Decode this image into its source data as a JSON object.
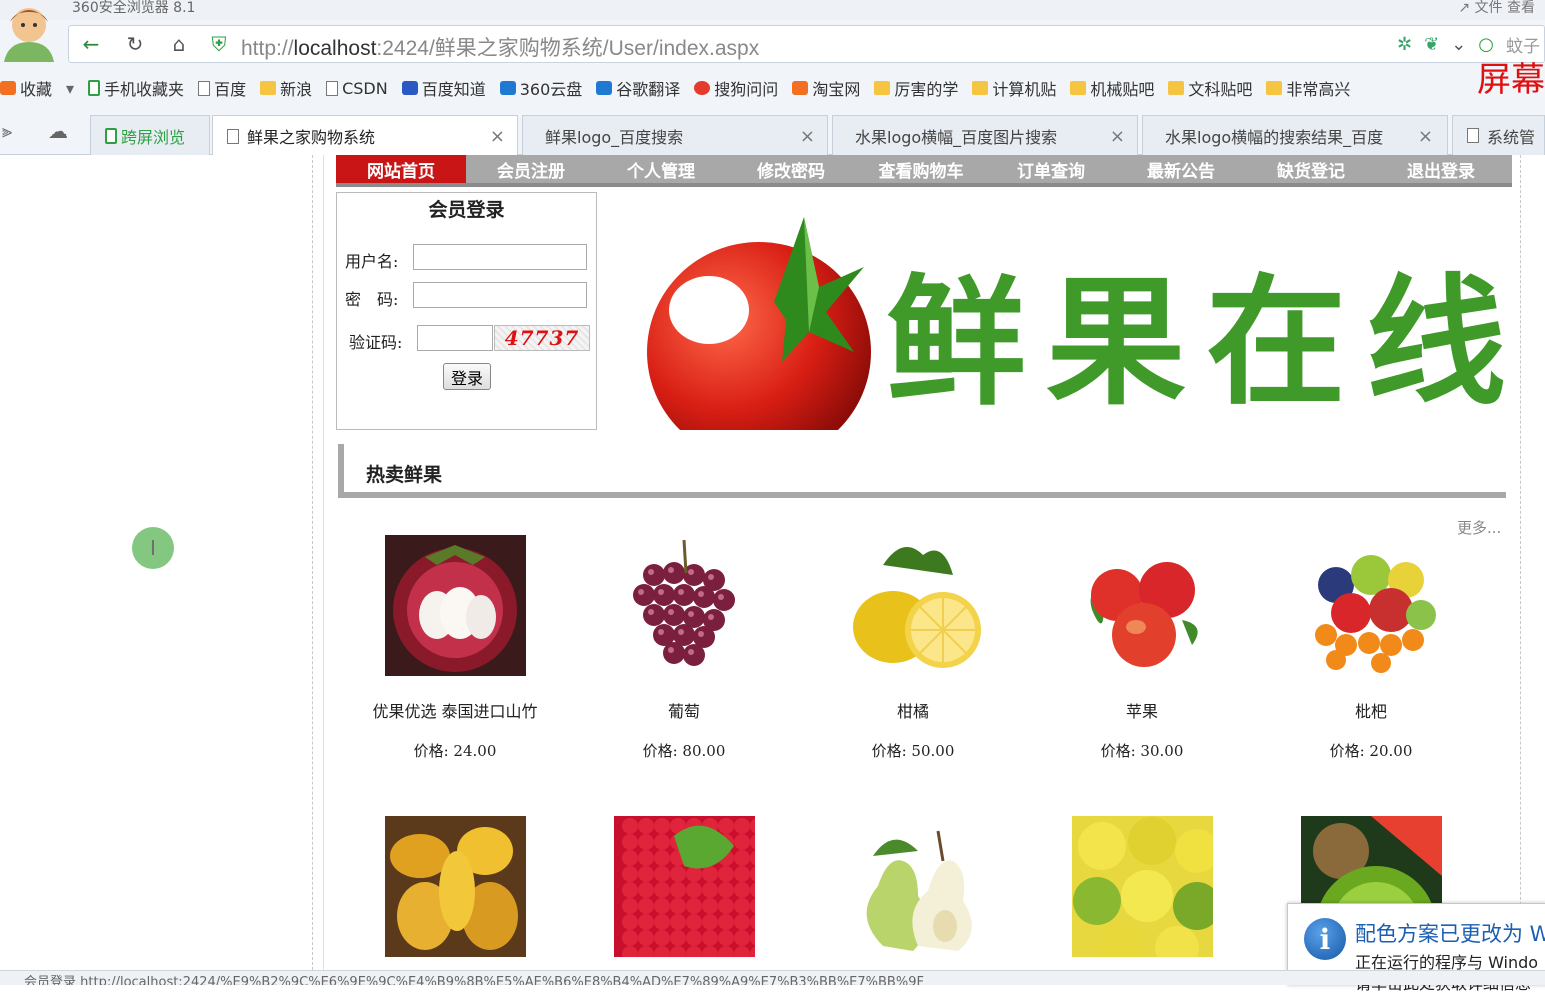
{
  "window": {
    "title": "360安全浏览器 8.1",
    "top_right": "↗ 文件    查看"
  },
  "address_bar": {
    "url_prefix": "http://",
    "url_host": "localhost",
    "url_rest": ":2424/鲜果之家购物系统/User/index.aspx",
    "search_hint": "蚊子"
  },
  "bookmarks": [
    {
      "label": "收藏",
      "icon": "star-icon"
    },
    {
      "label": "手机收藏夹",
      "icon": "phone-icon"
    },
    {
      "label": "百度",
      "icon": "page-icon"
    },
    {
      "label": "新浪",
      "icon": "folder-icon"
    },
    {
      "label": "CSDN",
      "icon": "page-icon"
    },
    {
      "label": "百度知道",
      "icon": "baidu-paw-icon"
    },
    {
      "label": "360云盘",
      "icon": "cloud-icon"
    },
    {
      "label": "谷歌翻译",
      "icon": "translate-icon"
    },
    {
      "label": "搜狗问问",
      "icon": "sogou-icon"
    },
    {
      "label": "淘宝网",
      "icon": "taobao-icon"
    },
    {
      "label": "厉害的学",
      "icon": "folder-icon"
    },
    {
      "label": "计算机贴",
      "icon": "folder-icon"
    },
    {
      "label": "机械贴吧",
      "icon": "folder-icon"
    },
    {
      "label": "文科贴吧",
      "icon": "folder-icon"
    },
    {
      "label": "非常高兴",
      "icon": "folder-icon"
    }
  ],
  "screen_label": "屏幕",
  "tabs": [
    {
      "label": "跨屏浏览"
    },
    {
      "label": "鲜果之家购物系统"
    },
    {
      "label": "鲜果logo_百度搜索"
    },
    {
      "label": "水果logo横幅_百度图片搜索"
    },
    {
      "label": "水果logo横幅的搜索结果_百度"
    },
    {
      "label": "系统管"
    }
  ],
  "site": {
    "menu": [
      "网站首页",
      "会员注册",
      "个人管理",
      "修改密码",
      "查看购物车",
      "订单查询",
      "最新公告",
      "缺货登记",
      "退出登录"
    ],
    "login": {
      "title": "会员登录",
      "username_label": "用户名:",
      "password_label": "密　码:",
      "captcha_label": "验证码:",
      "captcha_value": "47737",
      "button": "登录"
    },
    "banner_text": "鲜果在线",
    "section_title": "热卖鲜果",
    "more_link": "更多...",
    "products": [
      {
        "name": "优果优选 泰国进口山竹",
        "price": "价格: 24.00",
        "fruit": "mangosteen"
      },
      {
        "name": "葡萄",
        "price": "价格: 80.00",
        "fruit": "grape"
      },
      {
        "name": "柑橘",
        "price": "价格: 50.00",
        "fruit": "lemon"
      },
      {
        "name": "苹果",
        "price": "价格: 30.00",
        "fruit": "apple"
      },
      {
        "name": "枇杷",
        "price": "价格: 20.00",
        "fruit": "mixed-fruit"
      },
      {
        "name": "",
        "price": "",
        "fruit": "mango"
      },
      {
        "name": "",
        "price": "",
        "fruit": "raspberry"
      },
      {
        "name": "",
        "price": "",
        "fruit": "pear"
      },
      {
        "name": "",
        "price": "",
        "fruit": "citrus"
      },
      {
        "name": "",
        "price": "",
        "fruit": "kiwi"
      }
    ]
  },
  "notification": {
    "title": "配色方案已更改为 W",
    "line1": "正在运行的程序与 Windo",
    "line2": "请单击此处获取详细信息"
  },
  "status_bar": "会员登录 http://localhost:2424/%E9%B2%9C%E6%9E%9C%E4%B9%8B%E5%AE%B6%E8%B4%AD%E7%89%A9%E7%B3%BB%E7%BB%9F"
}
